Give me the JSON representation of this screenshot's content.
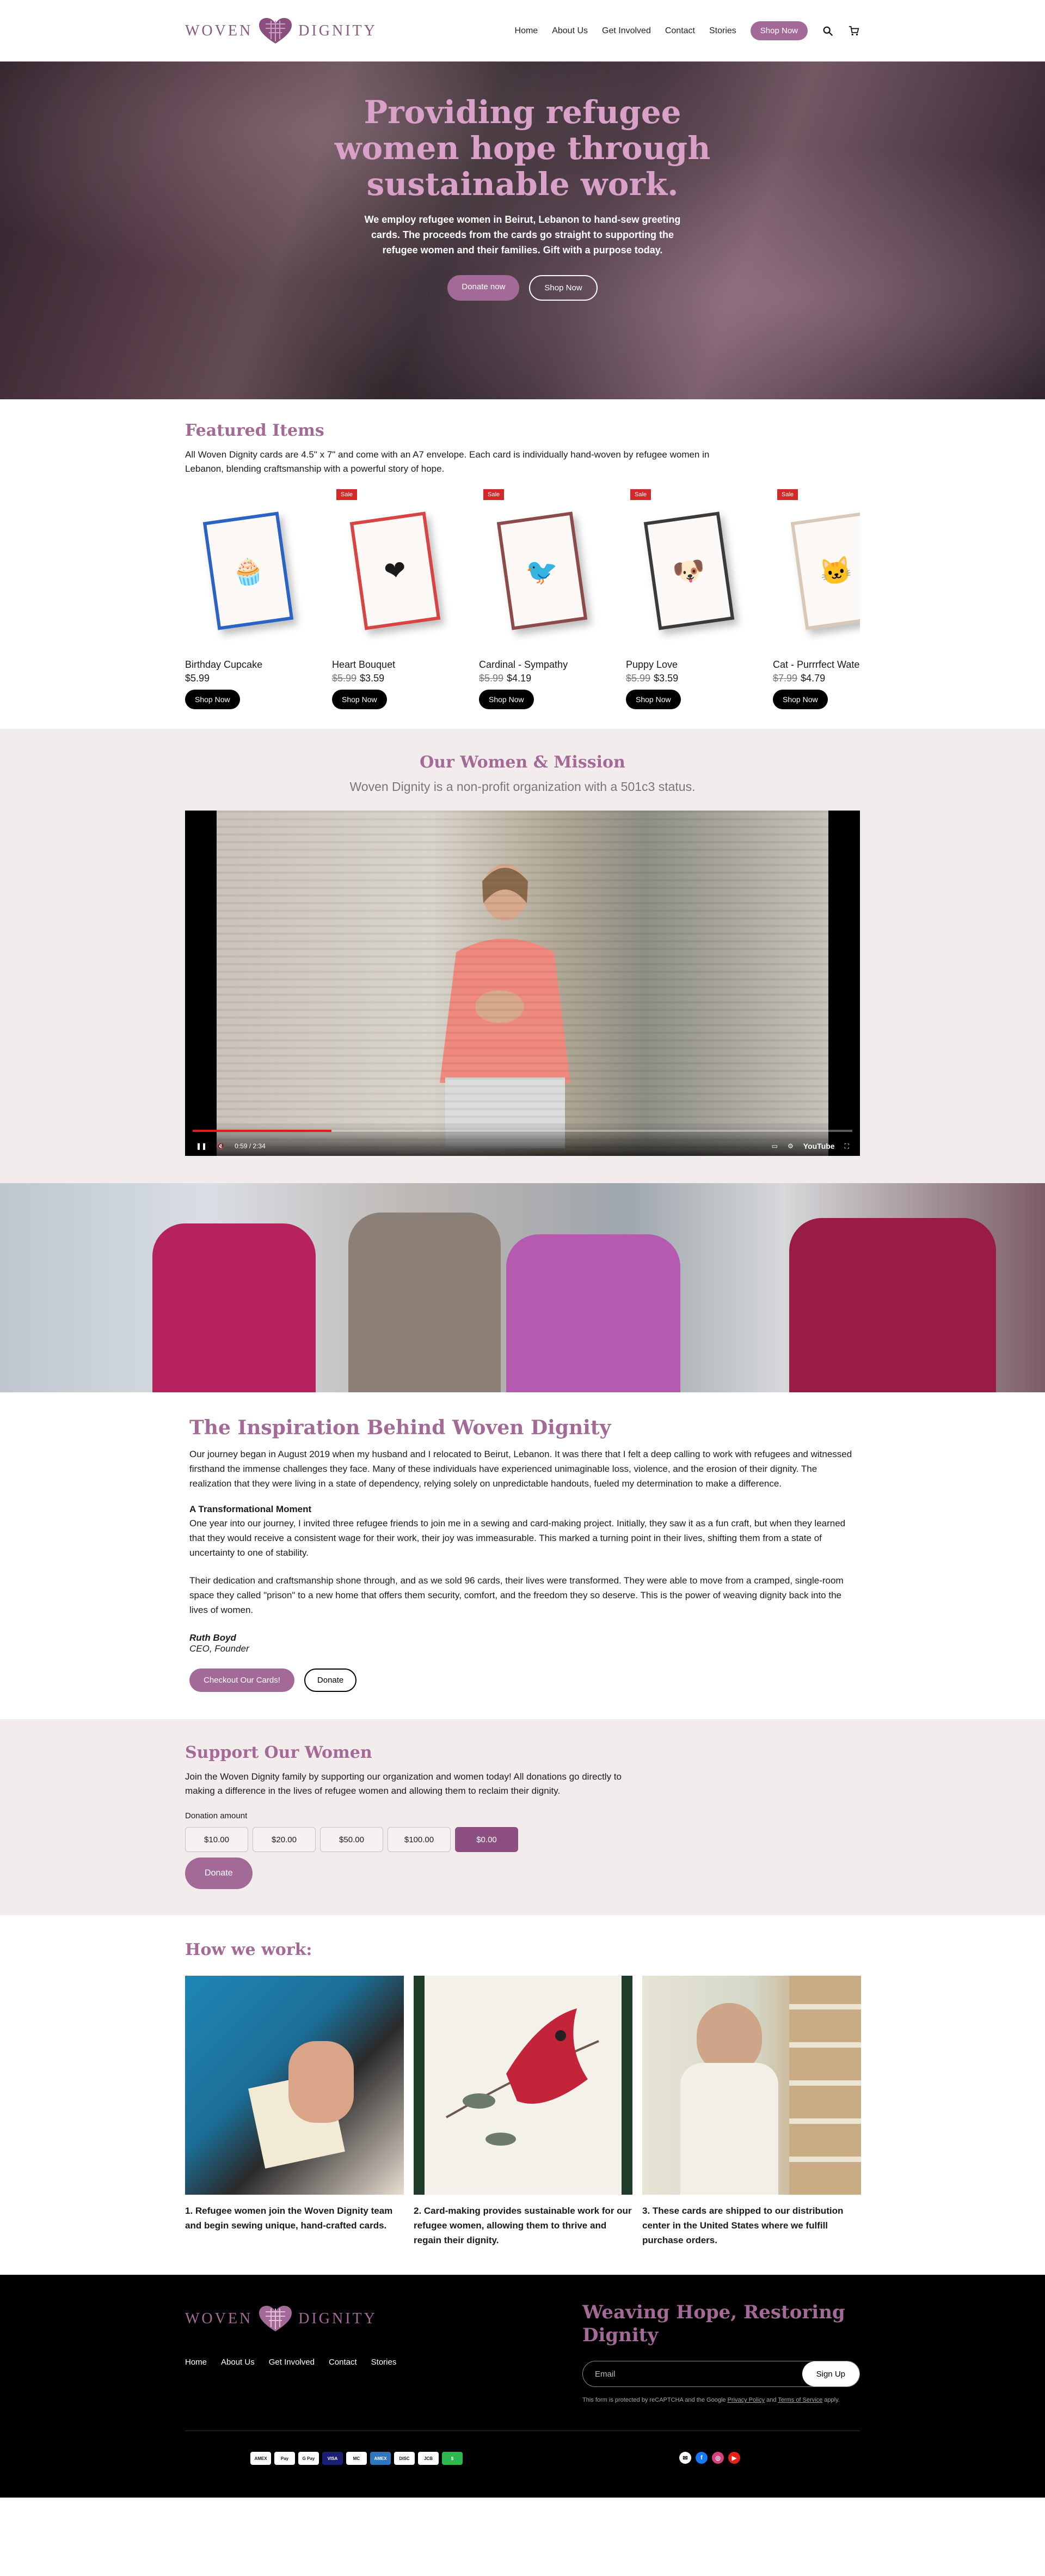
{
  "header": {
    "logo_left": "WOVEN",
    "logo_right": "DIGNITY",
    "nav": [
      "Home",
      "About Us",
      "Get Involved",
      "Contact",
      "Stories"
    ],
    "shop_now": "Shop Now"
  },
  "hero": {
    "title": "Providing refugee women hope through sustainable work.",
    "text": "We employ refugee women in Beirut, Lebanon to hand-sew greeting cards. The proceeds from the cards go straight to supporting the refugee women and their families. Gift with a purpose today.",
    "donate": "Donate now",
    "shop": "Shop Now"
  },
  "featured": {
    "title": "Featured Items",
    "description": "All Woven Dignity cards are 4.5\" x 7\" and come with an A7 envelope. Each card is individually hand-woven by refugee women in Lebanon, blending craftsmanship with a powerful story of hope.",
    "products": [
      {
        "name": "Birthday Cupcake",
        "sale": "",
        "old_price": "",
        "price": "$5.99",
        "button": "Shop Now",
        "border": "#2a63c4",
        "glyph": "🧁"
      },
      {
        "name": "Heart Bouquet",
        "sale": "Sale",
        "old_price": "$5.99",
        "price": "$3.59",
        "button": "Shop Now",
        "border": "#d84343",
        "glyph": "❤"
      },
      {
        "name": "Cardinal - Sympathy",
        "sale": "Sale",
        "old_price": "$5.99",
        "price": "$4.19",
        "button": "Shop Now",
        "border": "#8c4a4a",
        "glyph": "🐦"
      },
      {
        "name": "Puppy Love",
        "sale": "Sale",
        "old_price": "$5.99",
        "price": "$3.59",
        "button": "Shop Now",
        "border": "#3a3a3a",
        "glyph": "🐶"
      },
      {
        "name": "Cat - Purrrfect Wate",
        "sale": "Sale",
        "old_price": "$7.99",
        "price": "$4.79",
        "button": "Shop Now",
        "border": "#d8c8b8",
        "glyph": "🐱"
      }
    ]
  },
  "mission": {
    "title": "Our Women & Mission",
    "subtitle": "Woven Dignity is a non-profit organization with a 501c3 status.",
    "video_time": "0:59 / 2:34",
    "video_progress": 0.21,
    "youtube": "YouTube"
  },
  "inspiration": {
    "title": "The Inspiration Behind Woven Dignity",
    "p1": "Our journey began in August 2019 when my husband and I relocated to Beirut, Lebanon. It was there that I felt a deep calling to work with refugees and witnessed firsthand the immense challenges they face. Many of these individuals have experienced unimaginable loss, violence, and the erosion of their dignity. The realization that they were living in a state of dependency, relying solely on unpredictable handouts, fueled my determination to make a difference.",
    "subheading": "A Transformational Moment",
    "p2": "One year into our journey, I invited three refugee friends to join me in a sewing and card-making project. Initially, they saw it as a fun craft, but when they learned that they would receive a consistent wage for their work, their joy was immeasurable. This marked a turning point in their lives, shifting them from a state of uncertainty to one of stability.",
    "p3": "Their dedication and craftsmanship shone through, and as we sold 96 cards, their lives were transformed. They were able to move from a cramped, single-room space they called \"prison\" to a new home that offers them security, comfort, and the freedom they so deserve. This is the power of weaving dignity back into the lives of women.",
    "signature_name": "Ruth Boyd",
    "signature_title": "CEO, Founder",
    "btn_cards": "Checkout Our Cards!",
    "btn_donate": "Donate"
  },
  "support": {
    "title": "Support Our Women",
    "text": "Join the Woven Dignity family by supporting our organization and women today! All donations go directly to making a difference in the lives of refugee women and allowing them to reclaim their dignity.",
    "amount_label": "Donation amount",
    "amounts": [
      "$10.00",
      "$20.00",
      "$50.00",
      "$100.00",
      "$0.00"
    ],
    "selected_index": 4,
    "donate": "Donate"
  },
  "how": {
    "title": "How we work:",
    "steps": [
      "1. Refugee women join the Woven Dignity team and begin sewing unique, hand-crafted cards.",
      "2. Card-making provides sustainable work for our refugee women, allowing them to thrive and regain their dignity.",
      "3. These cards are shipped to our distribution center in the United States where we fulfill purchase orders."
    ]
  },
  "footer": {
    "logo_left": "WOVEN",
    "logo_right": "DIGNITY",
    "nav": [
      "Home",
      "About Us",
      "Get Involved",
      "Contact",
      "Stories"
    ],
    "tagline": "Weaving Hope, Restoring Dignity",
    "email_placeholder": "Email",
    "signup": "Sign Up",
    "recaptcha_pre": "This form is protected by reCAPTCHA and the Google ",
    "privacy": "Privacy Policy",
    "and": " and ",
    "terms": "Terms of Service",
    "recaptcha_post": " apply.",
    "payments": [
      "AMEX",
      "Pay",
      "G Pay",
      "VISA",
      "MC",
      "AMEX",
      "DISC",
      "JCB",
      "$"
    ],
    "socials": [
      "email-icon",
      "facebook-icon",
      "instagram-icon",
      "youtube-icon"
    ]
  }
}
